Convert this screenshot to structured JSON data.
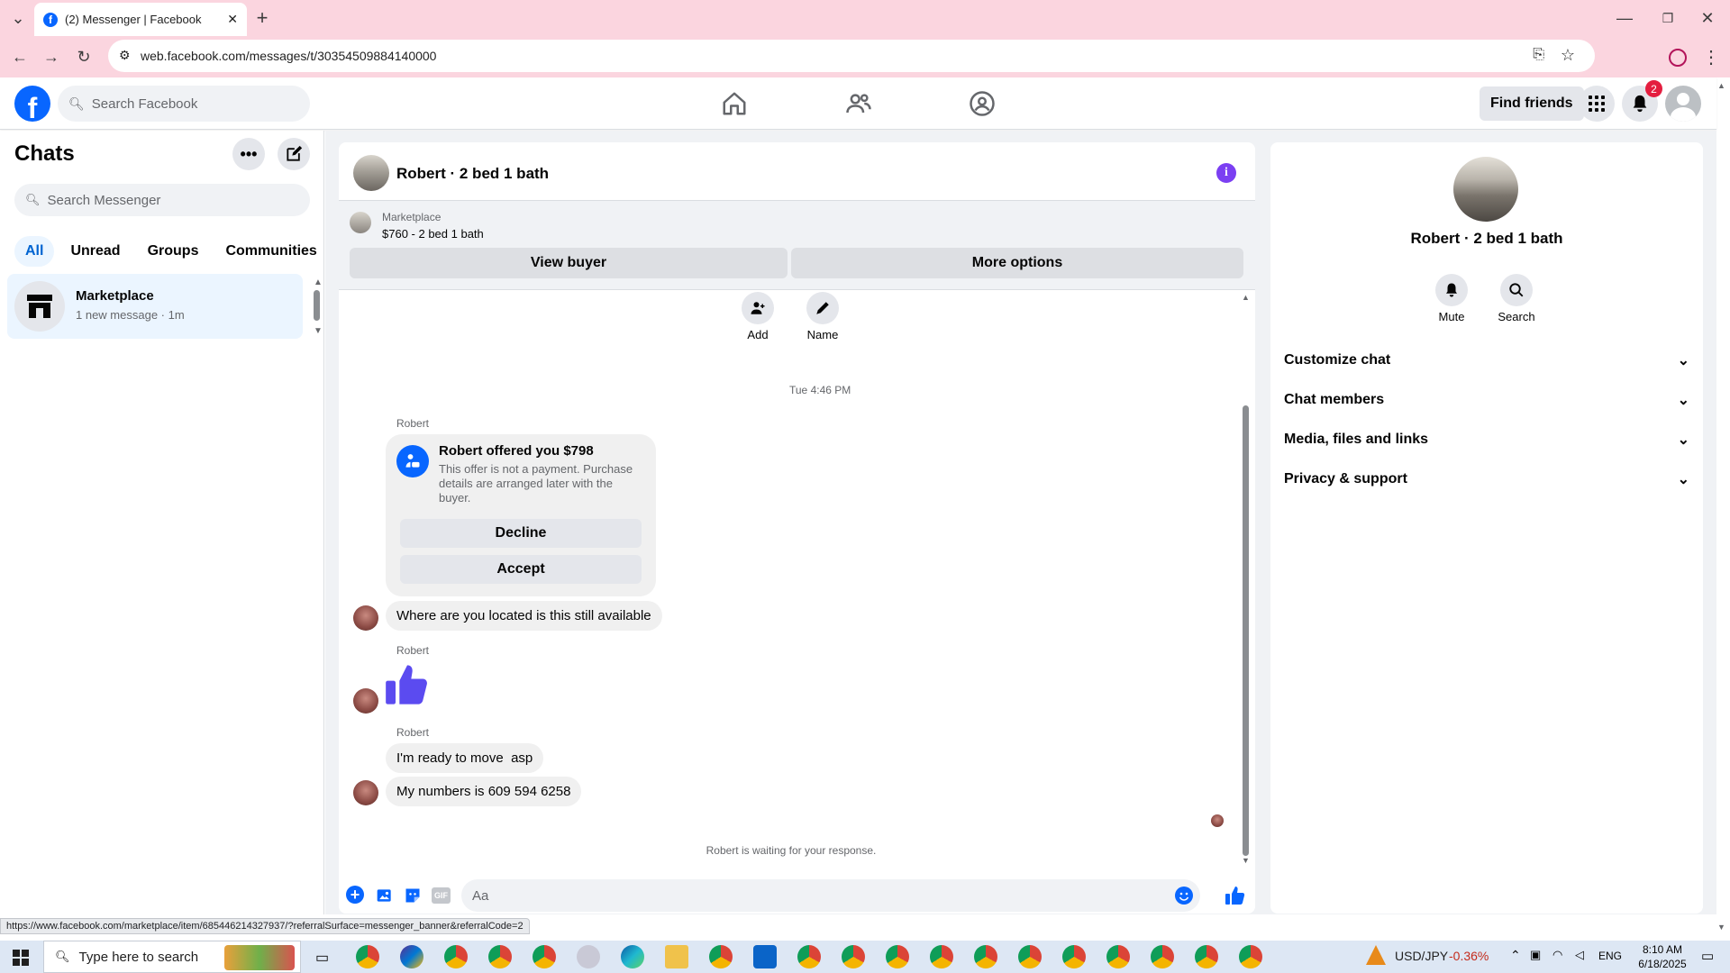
{
  "browser": {
    "tab_title": "(2) Messenger | Facebook",
    "url": "web.facebook.com/messages/t/30354509884140000",
    "status_url": "https://www.facebook.com/marketplace/item/685446214327937/?referralSurface=messenger_banner&referralCode=2"
  },
  "header": {
    "search_placeholder": "Search Facebook",
    "find_friends": "Find friends",
    "notification_count": "2"
  },
  "sidebar": {
    "title": "Chats",
    "search_placeholder": "Search Messenger",
    "filters": [
      "All",
      "Unread",
      "Groups",
      "Communities"
    ],
    "chat": {
      "name": "Marketplace",
      "preview": "1 new message · 1m"
    }
  },
  "chat": {
    "title": "Robert · 2 bed 1 bath",
    "banner_source": "Marketplace",
    "banner_listing": "$760 - 2 bed 1 bath",
    "view_buyer": "View buyer",
    "more_options": "More options",
    "add_label": "Add",
    "name_label": "Name",
    "timestamp": "Tue 4:46 PM",
    "sender": "Robert",
    "offer_title": "Robert offered you $798",
    "offer_desc": "This offer is not a payment. Purchase details are arranged later with the buyer.",
    "decline": "Decline",
    "accept": "Accept",
    "msg1": "Where are you located is this still available",
    "msg2": "I'm ready to move  asp",
    "msg3": "My numbers is 609 594 6258",
    "waiting": "Robert is waiting for your response.",
    "composer_placeholder": "Aa"
  },
  "right_panel": {
    "name": "Robert · 2 bed 1 bath",
    "mute": "Mute",
    "search": "Search",
    "sections": [
      "Customize chat",
      "Chat members",
      "Media, files and links",
      "Privacy & support"
    ]
  },
  "taskbar": {
    "search_placeholder": "Type here to search",
    "ticker": "USD/JPY",
    "ticker_change": "-0.36%",
    "lang": "ENG",
    "time": "8:10 AM",
    "date": "6/18/2025"
  },
  "colors": {
    "accent": "#0866ff",
    "messenger_purple": "#7b3ff2",
    "thumb": "#5b4bf0",
    "chrome_pink": "#fbd5df"
  }
}
